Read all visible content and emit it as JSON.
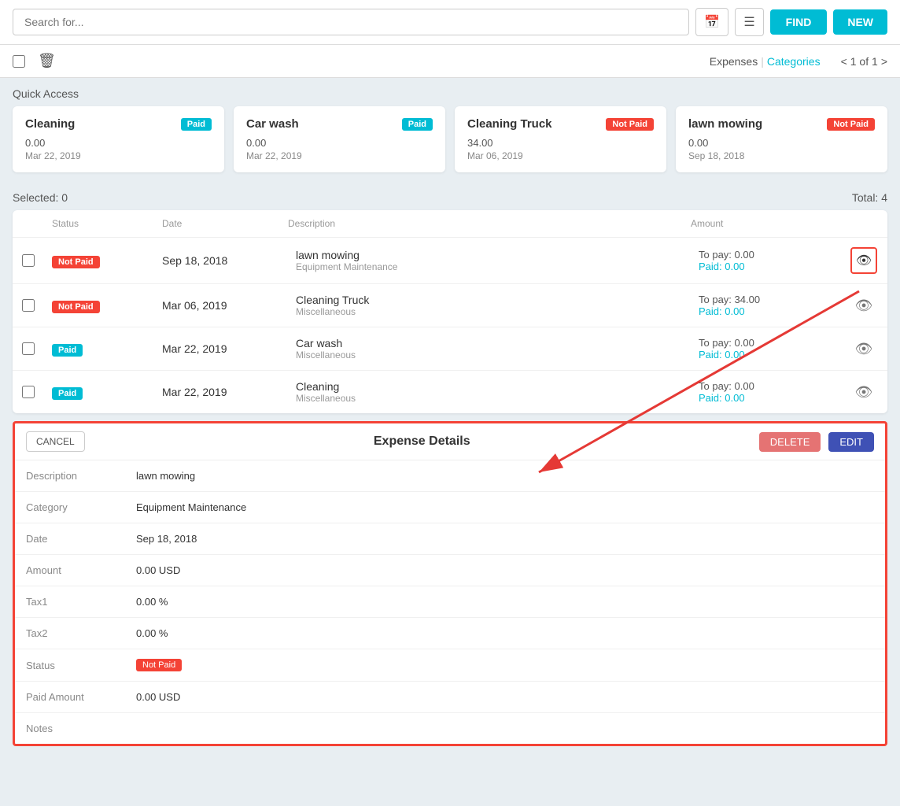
{
  "topbar": {
    "search_placeholder": "Search for...",
    "find_label": "FIND",
    "new_label": "NEW"
  },
  "subbar": {
    "expenses_label": "Expenses",
    "categories_label": "Categories",
    "page_current": "1",
    "page_total": "1"
  },
  "quick_access": {
    "section_label": "Quick Access",
    "cards": [
      {
        "title": "Cleaning",
        "status": "Paid",
        "amount": "0.00",
        "date": "Mar 22, 2019"
      },
      {
        "title": "Car wash",
        "status": "Paid",
        "amount": "0.00",
        "date": "Mar 22, 2019"
      },
      {
        "title": "Cleaning Truck",
        "status": "Not Paid",
        "amount": "34.00",
        "date": "Mar 06, 2019"
      },
      {
        "title": "lawn mowing",
        "status": "Not Paid",
        "amount": "0.00",
        "date": "Sep 18, 2018"
      }
    ]
  },
  "list_bar": {
    "selected_label": "Selected: 0",
    "total_label": "Total: 4"
  },
  "table": {
    "headers": [
      "",
      "Status",
      "Date",
      "Description",
      "Amount",
      ""
    ],
    "rows": [
      {
        "status": "Not Paid",
        "date": "Sep 18, 2018",
        "desc_main": "lawn mowing",
        "desc_sub": "Equipment Maintenance",
        "topay": "To pay: 0.00",
        "paid": "Paid: 0.00",
        "active": true
      },
      {
        "status": "Not Paid",
        "date": "Mar 06, 2019",
        "desc_main": "Cleaning Truck",
        "desc_sub": "Miscellaneous",
        "topay": "To pay: 34.00",
        "paid": "Paid: 0.00",
        "active": false
      },
      {
        "status": "Paid",
        "date": "Mar 22, 2019",
        "desc_main": "Car wash",
        "desc_sub": "Miscellaneous",
        "topay": "To pay: 0.00",
        "paid": "Paid: 0.00",
        "active": false
      },
      {
        "status": "Paid",
        "date": "Mar 22, 2019",
        "desc_main": "Cleaning",
        "desc_sub": "Miscellaneous",
        "topay": "To pay: 0.00",
        "paid": "Paid: 0.00",
        "active": false
      }
    ]
  },
  "expense_detail": {
    "cancel_label": "CANCEL",
    "title": "Expense Details",
    "delete_label": "DELETE",
    "edit_label": "EDIT",
    "fields": [
      {
        "label": "Description",
        "value": "lawn mowing",
        "type": "text"
      },
      {
        "label": "Category",
        "value": "Equipment Maintenance",
        "type": "text"
      },
      {
        "label": "Date",
        "value": "Sep 18, 2018",
        "type": "text"
      },
      {
        "label": "Amount",
        "value": "0.00 USD",
        "type": "text"
      },
      {
        "label": "Tax1",
        "value": "0.00 %",
        "type": "text"
      },
      {
        "label": "Tax2",
        "value": "0.00 %",
        "type": "text"
      },
      {
        "label": "Status",
        "value": "Not Paid",
        "type": "badge"
      },
      {
        "label": "Paid Amount",
        "value": "0.00 USD",
        "type": "text"
      },
      {
        "label": "Notes",
        "value": "",
        "type": "text"
      }
    ]
  }
}
